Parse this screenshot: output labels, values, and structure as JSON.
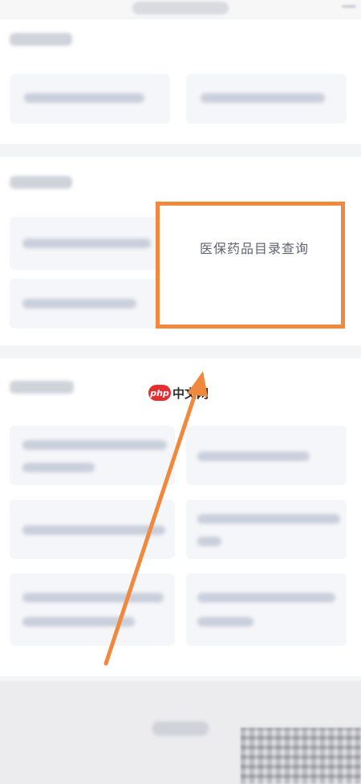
{
  "highlighted_item": {
    "label": "医保药品目录查询"
  },
  "watermark": {
    "badge": "php",
    "text": "中文网"
  },
  "colors": {
    "highlight": "#f0893d",
    "tile": "#f5f6f9",
    "watermark_red": "#e62e30"
  }
}
